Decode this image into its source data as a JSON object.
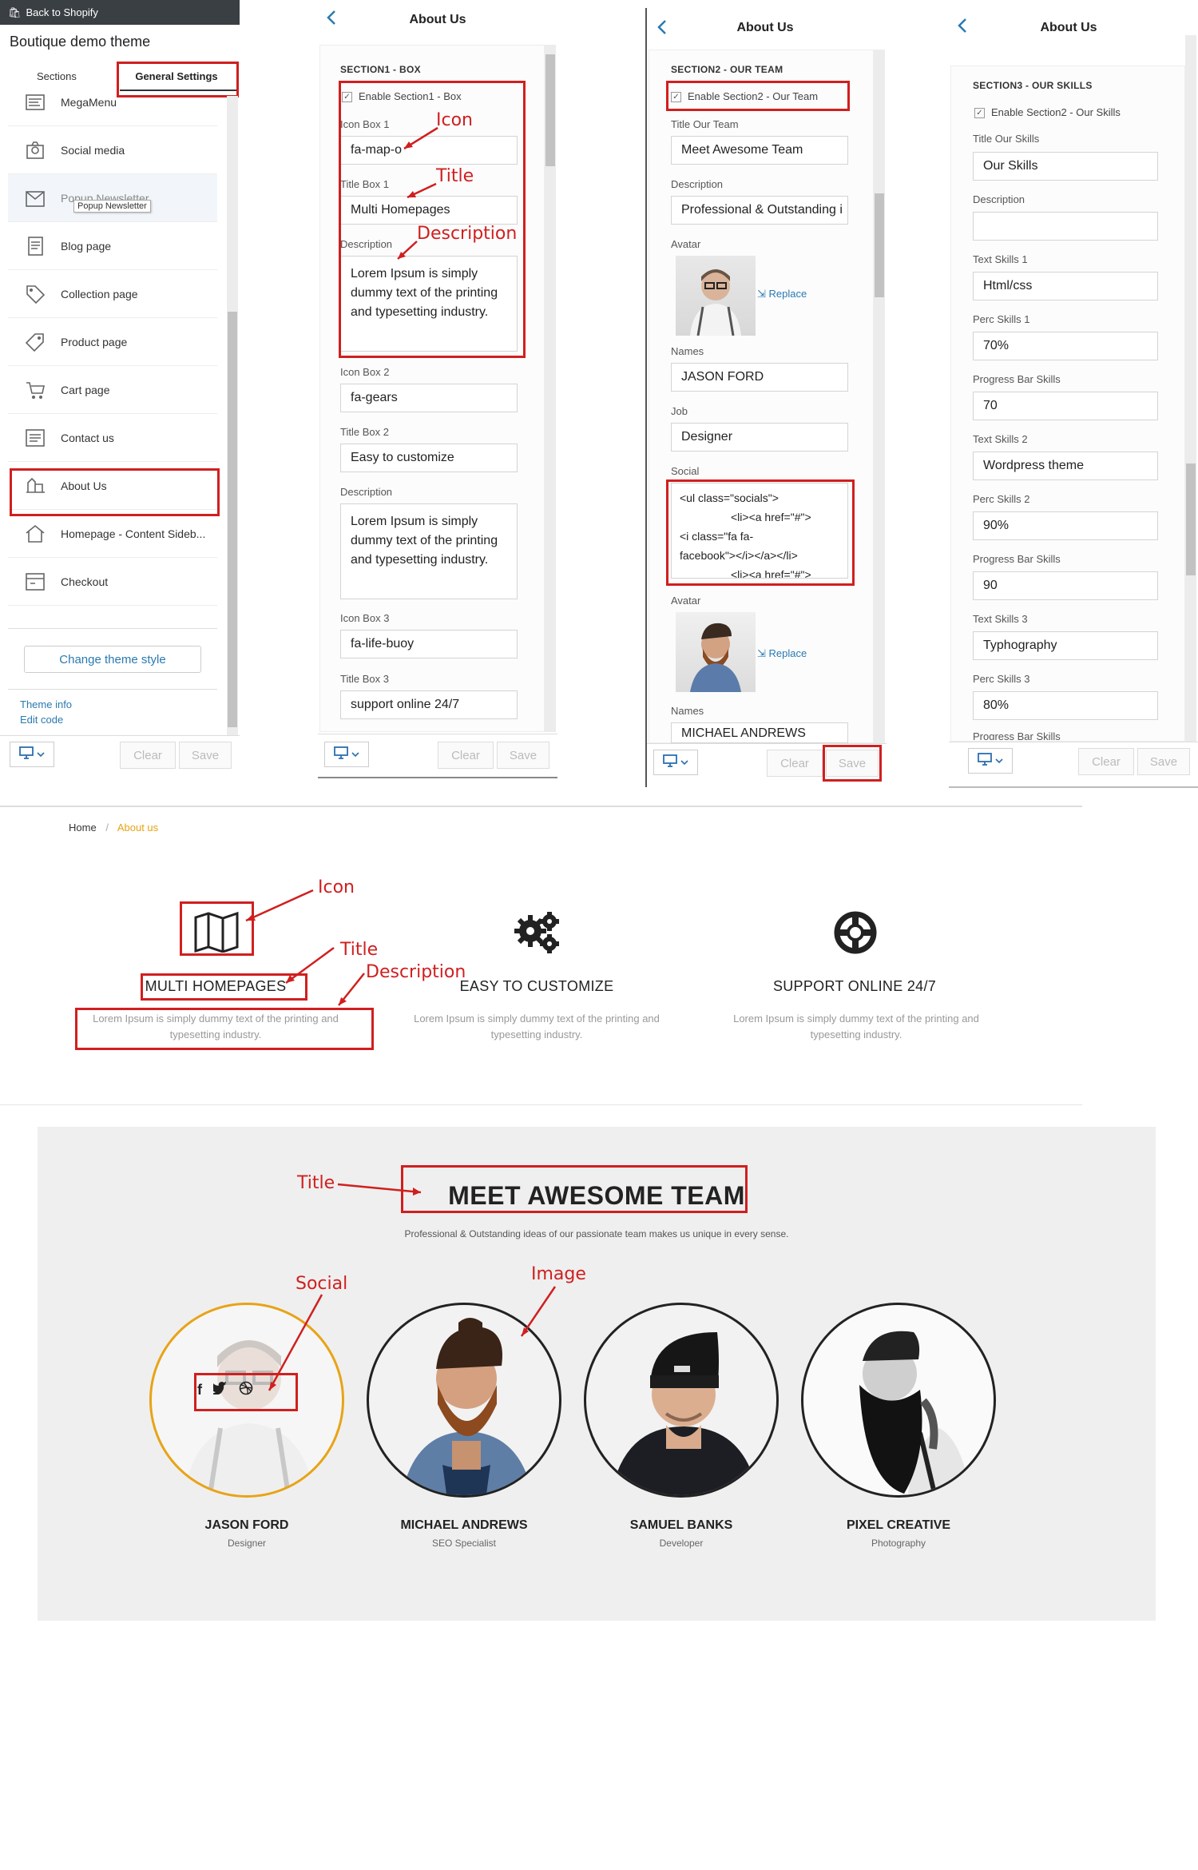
{
  "sidebar": {
    "back_label": "Back to Shopify",
    "theme_name": "Boutique demo theme",
    "tabs": [
      "Sections",
      "General Settings"
    ],
    "items": [
      {
        "label": "MegaMenu"
      },
      {
        "label": "Social media"
      },
      {
        "label": "Popup Newsletter"
      },
      {
        "label": "Blog page"
      },
      {
        "label": "Collection page"
      },
      {
        "label": "Product page"
      },
      {
        "label": "Cart page"
      },
      {
        "label": "Contact us"
      },
      {
        "label": "About Us"
      },
      {
        "label": "Homepage - Content Sideb..."
      },
      {
        "label": "Checkout"
      }
    ],
    "tooltip": "Popup Newsletter",
    "change_theme": "Change theme style",
    "theme_info": "Theme info",
    "edit_code": "Edit code",
    "clear": "Clear",
    "save": "Save"
  },
  "panel1": {
    "title": "About Us",
    "section": "SECTION1 - BOX",
    "enable": "Enable Section1 - Box",
    "icon1_label": "Icon Box 1",
    "icon1": "fa-map-o",
    "title1_label": "Title Box 1",
    "title1": "Multi Homepages",
    "desc_label": "Description",
    "desc1": "Lorem Ipsum is simply dummy text of the printing and typesetting industry.",
    "icon2_label": "Icon Box 2",
    "icon2": "fa-gears",
    "title2_label": "Title Box 2",
    "title2": "Easy to customize",
    "desc2": "Lorem Ipsum is simply dummy text of the printing and typesetting industry.",
    "icon3_label": "Icon Box 3",
    "icon3": "fa-life-buoy",
    "title3_label": "Title Box 3",
    "title3": "support online 24/7",
    "clear": "Clear",
    "save": "Save"
  },
  "panel2": {
    "title": "About Us",
    "section": "SECTION2 - OUR TEAM",
    "enable": "Enable Section2 - Our Team",
    "title_label": "Title Our Team",
    "title_value": "Meet Awesome Team",
    "desc_label": "Description",
    "desc_value": "Professional & Outstanding i",
    "avatar_label": "Avatar",
    "replace": "Replace",
    "names_label": "Names",
    "name1": "JASON FORD",
    "job_label": "Job",
    "job1": "Designer",
    "social_label": "Social",
    "social_lines": [
      "<ul class=\"socials\">",
      "<li><a href=\"#\">",
      "<i class=\"fa fa-",
      "facebook\"></i></a></li>",
      "<li><a href=\"#\">"
    ],
    "avatar2_label": "Avatar",
    "names2_label": "Names",
    "name2": "MICHAEL ANDREWS",
    "clear": "Clear",
    "save": "Save"
  },
  "panel3": {
    "title": "About Us",
    "section": "SECTION3 - OUR SKILLS",
    "enable": "Enable Section2 - Our Skills",
    "title_label": "Title Our Skills",
    "title_value": "Our Skills",
    "desc_label": "Description",
    "desc_value": "",
    "skills": [
      {
        "text_label": "Text Skills 1",
        "text": "Html/css",
        "perc_label": "Perc Skills 1",
        "perc": "70%",
        "bar_label": "Progress Bar Skills",
        "bar": "70"
      },
      {
        "text_label": "Text Skills 2",
        "text": "Wordpress theme",
        "perc_label": "Perc Skills 2",
        "perc": "90%",
        "bar_label": "Progress Bar Skills",
        "bar": "90"
      },
      {
        "text_label": "Text Skills 3",
        "text": "Typhography",
        "perc_label": "Perc Skills 3",
        "perc": "80%",
        "bar_label": "Progress Bar Skills",
        "bar": ""
      }
    ],
    "clear": "Clear",
    "save": "Save"
  },
  "breadcrumb": {
    "home": "Home",
    "sep": "/",
    "current": "About us"
  },
  "features": [
    {
      "icon": "map-icon",
      "title": "MULTI HOMEPAGES",
      "desc": "Lorem Ipsum is simply dummy text of the printing and typesetting industry."
    },
    {
      "icon": "gears-icon",
      "title": "EASY TO CUSTOMIZE",
      "desc": "Lorem Ipsum is simply dummy text of the printing and typesetting industry."
    },
    {
      "icon": "life-buoy-icon",
      "title": "SUPPORT ONLINE 24/7",
      "desc": "Lorem Ipsum is simply dummy text of the printing and typesetting industry."
    }
  ],
  "team": {
    "title": "MEET AWESOME TEAM",
    "subtitle": "Professional & Outstanding ideas of our passionate team makes us unique in every sense.",
    "members": [
      {
        "name": "JASON FORD",
        "job": "Designer"
      },
      {
        "name": "MICHAEL ANDREWS",
        "job": "SEO Specialist"
      },
      {
        "name": "SAMUEL BANKS",
        "job": "Developer"
      },
      {
        "name": "PIXEL CREATIVE",
        "job": "Photography"
      }
    ]
  },
  "annotations": {
    "icon": "Icon",
    "title": "Title",
    "description": "Description",
    "image": "Image",
    "social": "Social"
  },
  "colors": {
    "accent": "#e8a316",
    "annotation": "#d01f1f",
    "link": "#2a7ab0"
  }
}
